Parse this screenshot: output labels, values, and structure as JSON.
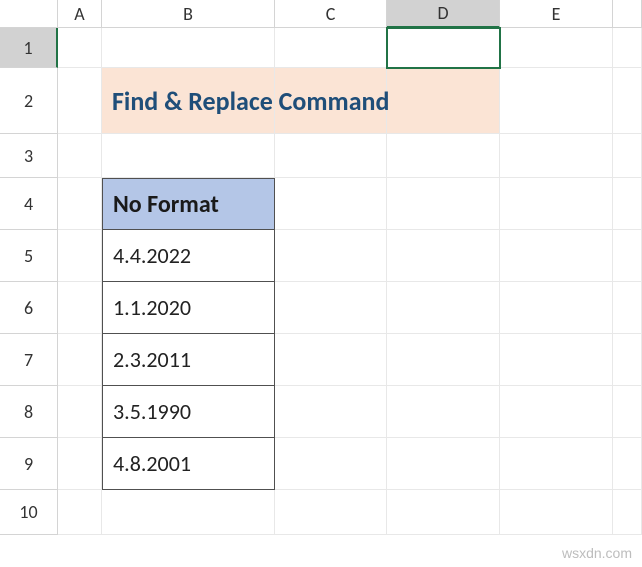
{
  "columns": [
    "A",
    "B",
    "C",
    "D",
    "E"
  ],
  "rows": [
    "1",
    "2",
    "3",
    "4",
    "5",
    "6",
    "7",
    "8",
    "9",
    "10"
  ],
  "title": "Find & Replace Command",
  "table_header": "No Format",
  "data": [
    "4.4.2022",
    "1.1.2020",
    "2.3.2011",
    "3.5.1990",
    "4.8.2001"
  ],
  "watermark": "wsxdn.com",
  "active_cell": "D1",
  "colors": {
    "title_bg": "#fbe4d5",
    "title_fg": "#1f4e79",
    "header_bg": "#b4c6e7",
    "selection_border": "#217346"
  },
  "chart_data": {
    "type": "table",
    "title": "Find & Replace Command",
    "columns": [
      "No Format"
    ],
    "rows": [
      [
        "4.4.2022"
      ],
      [
        "1.1.2020"
      ],
      [
        "2.3.2011"
      ],
      [
        "3.5.1990"
      ],
      [
        "4.8.2001"
      ]
    ]
  }
}
